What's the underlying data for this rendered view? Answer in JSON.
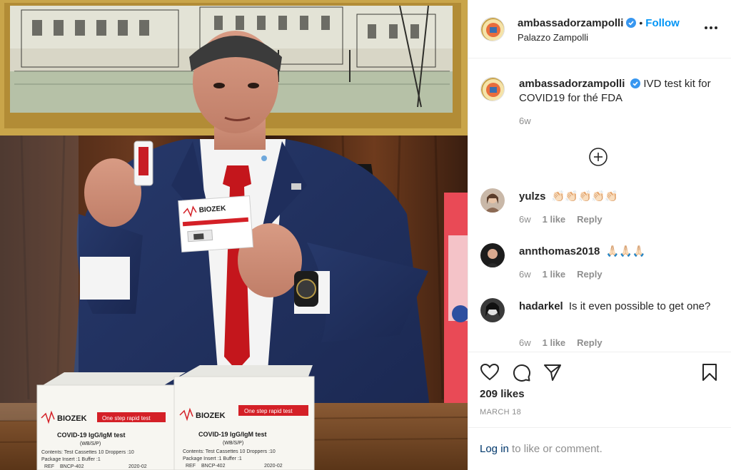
{
  "post": {
    "author": "ambassadorzampolli",
    "follow_label": "Follow",
    "separator": "•",
    "location": "Palazzo Zampolli"
  },
  "photo": {
    "kit_brand": "BIOZEK",
    "kit_tagline": "One step rapid test",
    "kit_product": "COVID-19 IgG/IgM test",
    "kit_specimen": "(WB/S/P)",
    "kit_contents": "Contents: Test Cassettes 10  Droppers :10",
    "kit_contents2": "Package Insert :1  Buffer :1",
    "kit_ref": "REF",
    "kit_ref_code": "BNCP-402",
    "kit_date": "2020-02"
  },
  "caption": {
    "author": "ambassadorzampolli",
    "text": "IVD test kit for COVID19 for thé FDA",
    "time": "6w"
  },
  "comments": [
    {
      "author": "yulzs",
      "text": "👏🏻👏🏻👏🏻👏🏻👏🏻",
      "time": "6w",
      "likes": "1 like",
      "reply": "Reply"
    },
    {
      "author": "annthomas2018",
      "text": "🙏🏻🙏🏻🙏🏻",
      "time": "6w",
      "likes": "1 like",
      "reply": "Reply"
    },
    {
      "author": "hadarkel",
      "text": "Is it even possible to get one?",
      "time": "6w",
      "likes": "1 like",
      "reply": "Reply"
    }
  ],
  "engagement": {
    "likes": "209 likes",
    "date": "MARCH 18"
  },
  "footer": {
    "login_link": "Log in",
    "login_rest": " to like or comment."
  },
  "colors": {
    "accent": "#0095f6",
    "link_dark": "#00376b",
    "muted": "#8e8e8e",
    "verified": "#3897f0",
    "kit_red": "#d42027"
  }
}
